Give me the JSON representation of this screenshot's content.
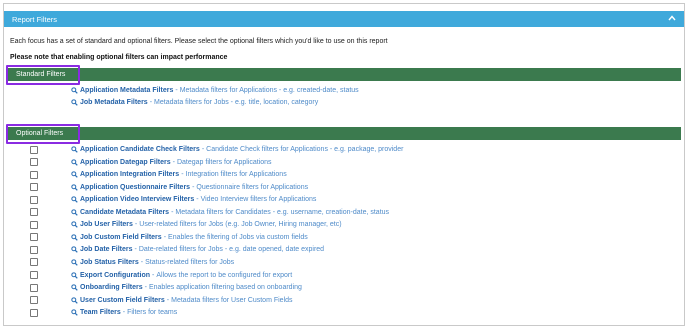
{
  "header": {
    "title": "Report Filters",
    "collapse_icon": "chevron-up-icon"
  },
  "intro_text": "Each focus has a set of standard and optional filters. Please select the optional filters which you'd like to use on this report",
  "warning_text": "Please note that enabling optional filters can impact performance",
  "standard": {
    "title": "Standard Filters",
    "items": [
      {
        "name": "Application Metadata Filters",
        "desc": "Metadata filters for Applications - e.g. created-date, status"
      },
      {
        "name": "Job Metadata Filters",
        "desc": "Metadata filters for Jobs - e.g. title, location, category"
      }
    ]
  },
  "optional": {
    "title": "Optional Filters",
    "items": [
      {
        "name": "Application Candidate Check Filters",
        "desc": "Candidate Check filters for Applications - e.g. package, provider"
      },
      {
        "name": "Application Dategap Filters",
        "desc": "Dategap filters for Applications"
      },
      {
        "name": "Application Integration Filters",
        "desc": "Integration filters for Applications"
      },
      {
        "name": "Application Questionnaire Filters",
        "desc": "Questionnaire filters for Applications"
      },
      {
        "name": "Application Video Interview Filters",
        "desc": "Video Interview filters for Applications"
      },
      {
        "name": "Candidate Metadata Filters",
        "desc": "Metadata filters for Candidates - e.g. username, creation-date, status"
      },
      {
        "name": "Job User Filters",
        "desc": "User-related filters for Jobs (e.g. Job Owner, Hiring manager, etc)"
      },
      {
        "name": "Job Custom Field Filters",
        "desc": "Enables the filtering of Jobs via custom fields"
      },
      {
        "name": "Job Date Filters",
        "desc": "Date-related filters for Jobs - e.g. date opened, date expired"
      },
      {
        "name": "Job Status Filters",
        "desc": "Status-related filters for Jobs"
      },
      {
        "name": "Export Configuration",
        "desc": "Allows the report to be configured for export"
      },
      {
        "name": "Onboarding Filters",
        "desc": "Enables application filtering based on onboarding"
      },
      {
        "name": "User Custom Field Filters",
        "desc": "Metadata filters for User Custom Fields"
      },
      {
        "name": "Team Filters",
        "desc": "Filters for teams"
      }
    ]
  },
  "colors": {
    "header_bg": "#3fa9db",
    "section_bg": "#3b7a4e",
    "highlight": "#8a2be2",
    "link": "#2462a8"
  }
}
